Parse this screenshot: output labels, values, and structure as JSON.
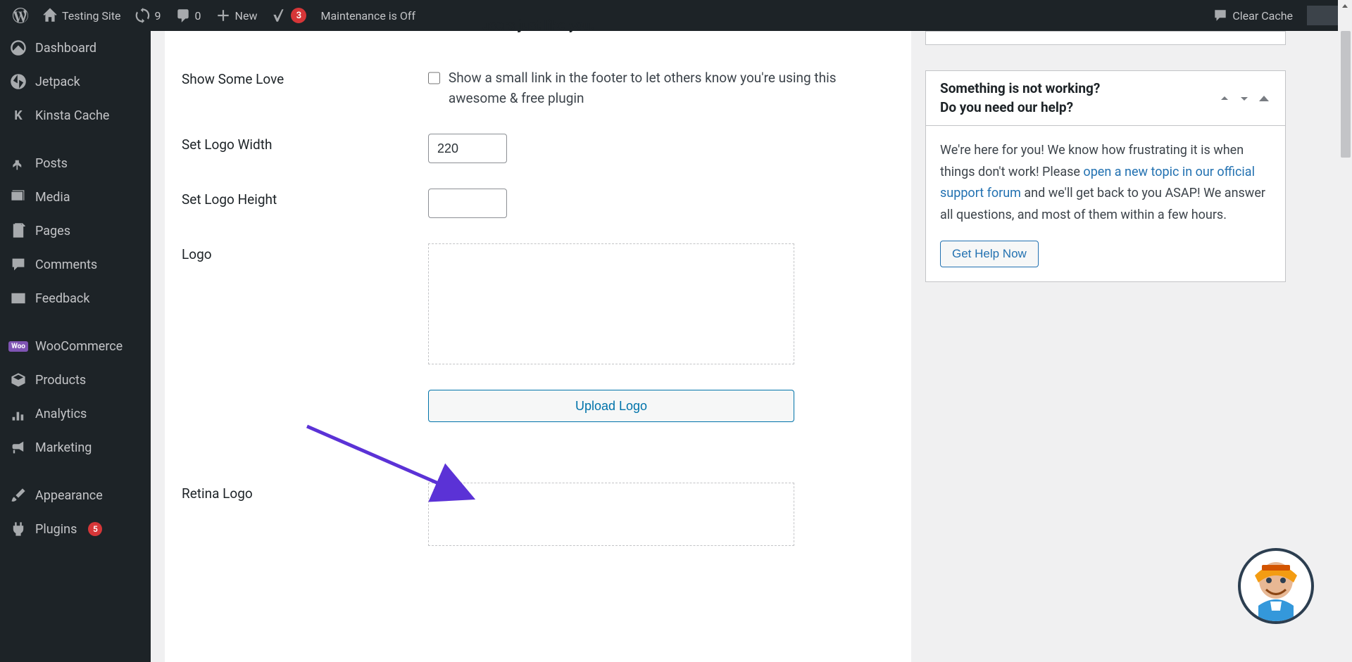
{
  "adminBar": {
    "siteName": "Testing Site",
    "updateCount": "9",
    "commentCount": "0",
    "newLabel": "New",
    "yoastCount": "3",
    "maintenanceLabel": "Maintenance is Off",
    "clearCacheLabel": "Clear Cache"
  },
  "sidebar": {
    "items": [
      {
        "label": "Dashboard"
      },
      {
        "label": "Jetpack"
      },
      {
        "label": "Kinsta Cache"
      },
      {
        "label": "Posts"
      },
      {
        "label": "Media"
      },
      {
        "label": "Pages"
      },
      {
        "label": "Comments"
      },
      {
        "label": "Feedback"
      },
      {
        "label": "WooCommerce"
      },
      {
        "label": "Products"
      },
      {
        "label": "Analytics"
      },
      {
        "label": "Marketing"
      },
      {
        "label": "Appearance"
      },
      {
        "label": "Plugins",
        "badge": "5"
      }
    ]
  },
  "form": {
    "fragmentText": "users just like you.",
    "showLove": {
      "label": "Show Some Love",
      "description": "Show a small link in the footer to let others know you're using this awesome & free plugin"
    },
    "logoWidth": {
      "label": "Set Logo Width",
      "value": "220"
    },
    "logoHeight": {
      "label": "Set Logo Height",
      "value": ""
    },
    "logo": {
      "label": "Logo",
      "uploadBtn": "Upload Logo"
    },
    "retinaLogo": {
      "label": "Retina Logo"
    }
  },
  "help": {
    "title1": "Something is not working?",
    "title2": "Do you need our help?",
    "text1": "We're here for you! We know how frustrating it is when things don't work! Please ",
    "link": "open a new topic in our official support forum",
    "text2": " and we'll get back to you ASAP! We answer all questions, and most of them within a few hours.",
    "btn": "Get Help Now"
  }
}
